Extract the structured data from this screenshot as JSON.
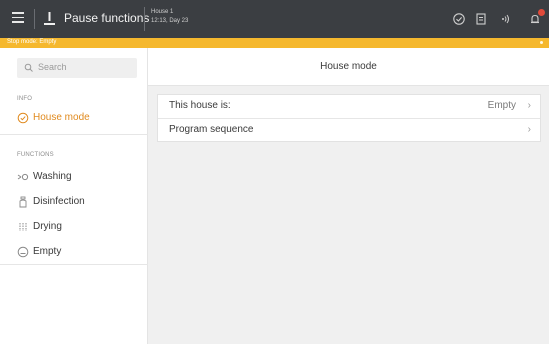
{
  "topbar": {
    "title": "Pause functions",
    "house_name": "House 1",
    "time_day": "12:13, Day 23",
    "icons": [
      "menu-icon",
      "pause-functions-icon",
      "check-circle-icon",
      "document-icon",
      "wifi-signal-icon",
      "bell-icon"
    ],
    "alert_color": "#e04a3a"
  },
  "modebar": {
    "text": "Stop mode: Empty",
    "color": "#f5b82e"
  },
  "sidebar": {
    "search_placeholder": "Search",
    "info_label": "INFO",
    "info_items": [
      {
        "label": "House mode",
        "icon": "check-circle-icon",
        "active": true
      }
    ],
    "functions_label": "FUNCTIONS",
    "function_items": [
      {
        "label": "Washing",
        "icon": "washing-icon"
      },
      {
        "label": "Disinfection",
        "icon": "disinfection-icon"
      },
      {
        "label": "Drying",
        "icon": "drying-icon"
      },
      {
        "label": "Empty",
        "icon": "empty-icon"
      }
    ],
    "accent_color": "#e08a1e"
  },
  "main": {
    "header_title": "House mode",
    "rows": [
      {
        "label": "This house is:",
        "value": "Empty",
        "chevron": "›"
      },
      {
        "label": "Program sequence",
        "value": "",
        "chevron": "›"
      }
    ]
  }
}
